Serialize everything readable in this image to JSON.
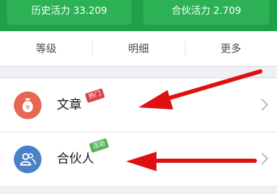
{
  "stats": {
    "history": "历史活力 33.209",
    "partner": "合伙活力 2.709"
  },
  "tabs": [
    "等级",
    "明细",
    "更多"
  ],
  "list": [
    {
      "label": "文章",
      "tag": "热门",
      "icon": "money-bag-icon"
    },
    {
      "label": "合伙人",
      "tag": "活动",
      "icon": "people-icon"
    }
  ],
  "colors": {
    "header_green": "#1fa049",
    "stat_green": "#2cb255",
    "article_icon": "#e86654",
    "partner_icon": "#4b82c7",
    "hot_tag": "#d9434b",
    "activity_tag": "#58b35b",
    "annotation_arrow": "#e01010"
  }
}
